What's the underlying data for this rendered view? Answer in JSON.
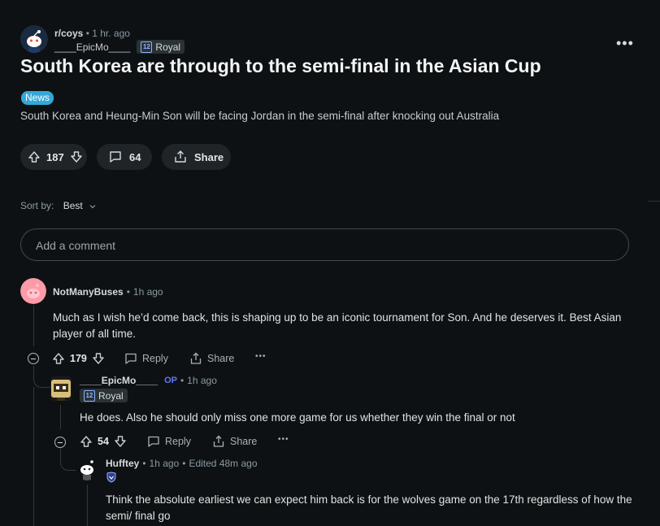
{
  "post": {
    "subreddit": "r/coys",
    "time": "1 hr. ago",
    "author": "____EpicMo____",
    "flair_badge": "12",
    "flair_text": "Royal",
    "more": "•••",
    "title": "South Korea are through to the semi-final in the Asian Cup",
    "tag": "News",
    "body": "South Korea and Heung-Min Son will be facing Jordan in the semi-final after knocking out Australia",
    "score": "187",
    "comments": "64",
    "share": "Share"
  },
  "sort": {
    "label": "Sort by:",
    "value": "Best"
  },
  "comment_box": {
    "placeholder": "Add a comment"
  },
  "comments": [
    {
      "author": "NotManyBuses",
      "time": "1h ago",
      "text": "Much as I wish he’d come back, this is shaping up to be an iconic tournament for Son. And he deserves it. Best Asian player of all time.",
      "score": "179",
      "reply": "Reply",
      "share": "Share",
      "more": "•••"
    },
    {
      "author": "____EpicMo____",
      "op": "OP",
      "time": "1h ago",
      "flair_badge": "12",
      "flair_text": "Royal",
      "text": "He does. Also he should only miss one more game for us whether they win the final or not",
      "score": "54",
      "reply": "Reply",
      "share": "Share",
      "more": "•••"
    },
    {
      "author": "Hufftey",
      "time": "1h ago",
      "edited": "Edited 48m ago",
      "text": "Think the absolute earliest we can expect him back is for the wolves game on the 17th regardless of how the semi/ final go"
    }
  ],
  "colors": {
    "background": "#0e1113",
    "tag": "#33a8d8",
    "op": "#5c7cff",
    "pill": "#1e2427"
  }
}
